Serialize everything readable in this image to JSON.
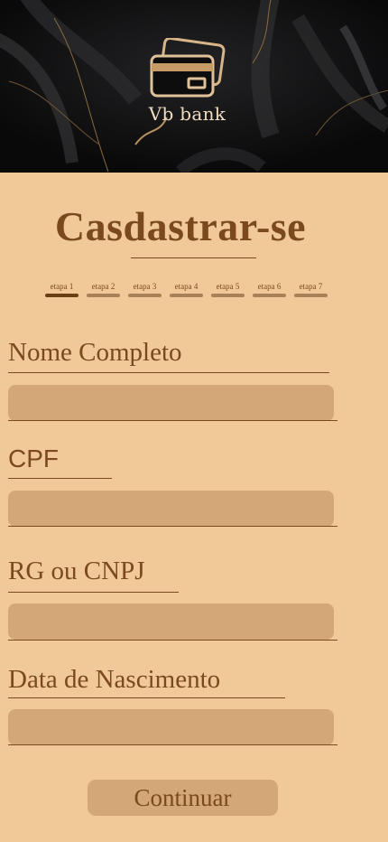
{
  "header": {
    "brand_name": "Vb bank",
    "logo_icon": "credit-cards-icon"
  },
  "form": {
    "title": "Casdastrar-se",
    "steps": [
      {
        "label": "etapa 1",
        "active": true
      },
      {
        "label": "etapa 2",
        "active": false
      },
      {
        "label": "etapa 3",
        "active": false
      },
      {
        "label": "etapa 4",
        "active": false
      },
      {
        "label": "etapa 5",
        "active": false
      },
      {
        "label": "etapa 6",
        "active": false
      },
      {
        "label": "etapa 7",
        "active": false
      }
    ],
    "fields": {
      "nome": {
        "label": "Nome Completo",
        "value": ""
      },
      "cpf": {
        "label": "CPF",
        "value": ""
      },
      "rg": {
        "label": "RG ou CNPJ",
        "value": ""
      },
      "nascimento": {
        "label": "Data de Nascimento",
        "value": ""
      }
    },
    "submit_label": "Continuar"
  },
  "colors": {
    "background": "#f1c897",
    "accent": "#7a4a1e",
    "input_fill": "#d3a776",
    "active_step": "#6b3f16",
    "inactive_step": "#a98158"
  }
}
